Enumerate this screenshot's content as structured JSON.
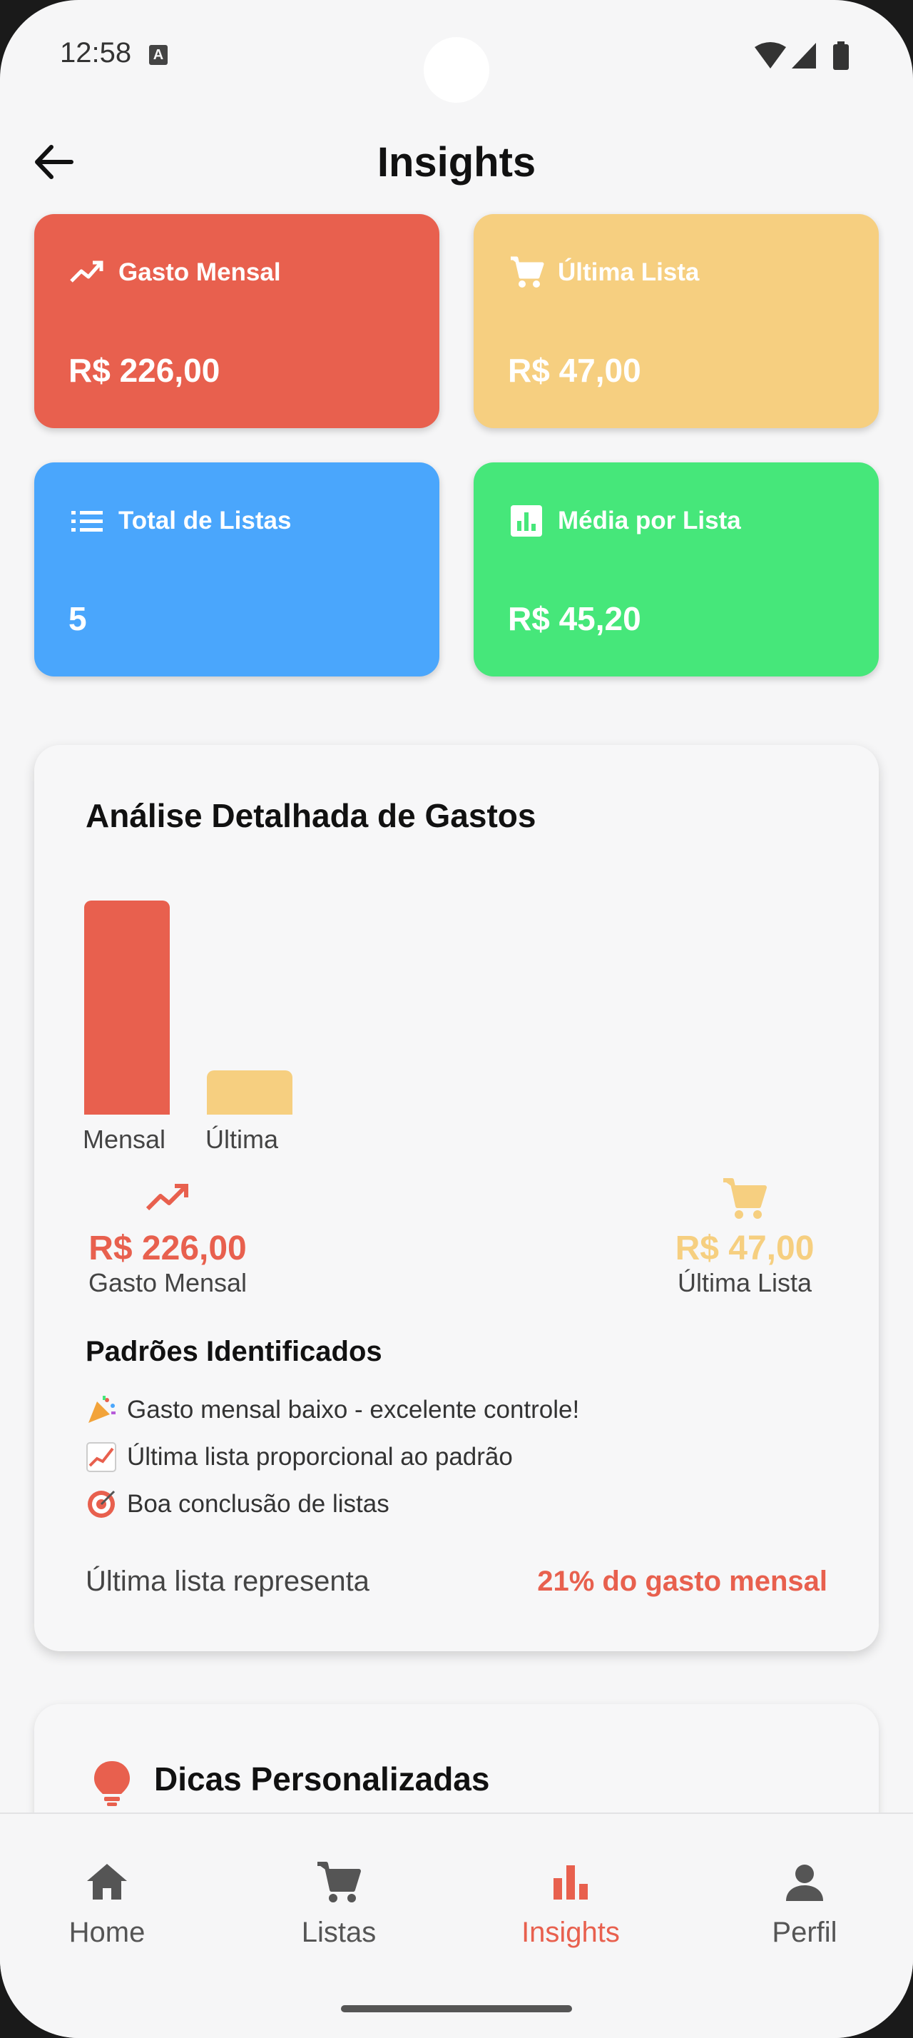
{
  "status_bar": {
    "time": "12:58",
    "notif_glyph": "A"
  },
  "app_bar": {
    "title": "Insights",
    "back_icon": "arrow-left-icon"
  },
  "stats": [
    {
      "label": "Gasto Mensal",
      "value": "R$ 226,00",
      "icon": "trending-up-icon",
      "color": "#e8604e"
    },
    {
      "label": "Última Lista",
      "value": "R$ 47,00",
      "icon": "cart-icon",
      "color": "#f6cf80"
    },
    {
      "label": "Total de Listas",
      "value": "5",
      "icon": "list-icon",
      "color": "#4aa6fc"
    },
    {
      "label": "Média por Lista",
      "value": "R$ 45,20",
      "icon": "bar-chart-icon",
      "color": "#46e77a"
    }
  ],
  "analysis": {
    "title": "Análise Detalhada de Gastos",
    "kpis": {
      "monthly": {
        "value": "R$ 226,00",
        "label": "Gasto Mensal"
      },
      "last": {
        "value": "R$ 47,00",
        "label": "Última Lista"
      }
    },
    "patterns_title": "Padrões Identificados",
    "patterns": [
      "Gasto mensal baixo - excelente controle!",
      "Última lista proporcional ao padrão",
      "Boa conclusão de listas"
    ],
    "summary_label": "Última lista representa",
    "summary_value": "21% do gasto mensal"
  },
  "chart_data": {
    "type": "bar",
    "categories": [
      "Mensal",
      "Última"
    ],
    "values": [
      226,
      47
    ],
    "colors": [
      "#e8604e",
      "#f6cf80"
    ],
    "title": "",
    "xlabel": "",
    "ylabel": ""
  },
  "tips": {
    "title": "Dicas Personalizadas"
  },
  "nav": {
    "items": [
      {
        "label": "Home",
        "icon": "home-icon"
      },
      {
        "label": "Listas",
        "icon": "cart-icon"
      },
      {
        "label": "Insights",
        "icon": "bar-chart-icon"
      },
      {
        "label": "Perfil",
        "icon": "person-icon"
      }
    ],
    "active_index": 2
  }
}
